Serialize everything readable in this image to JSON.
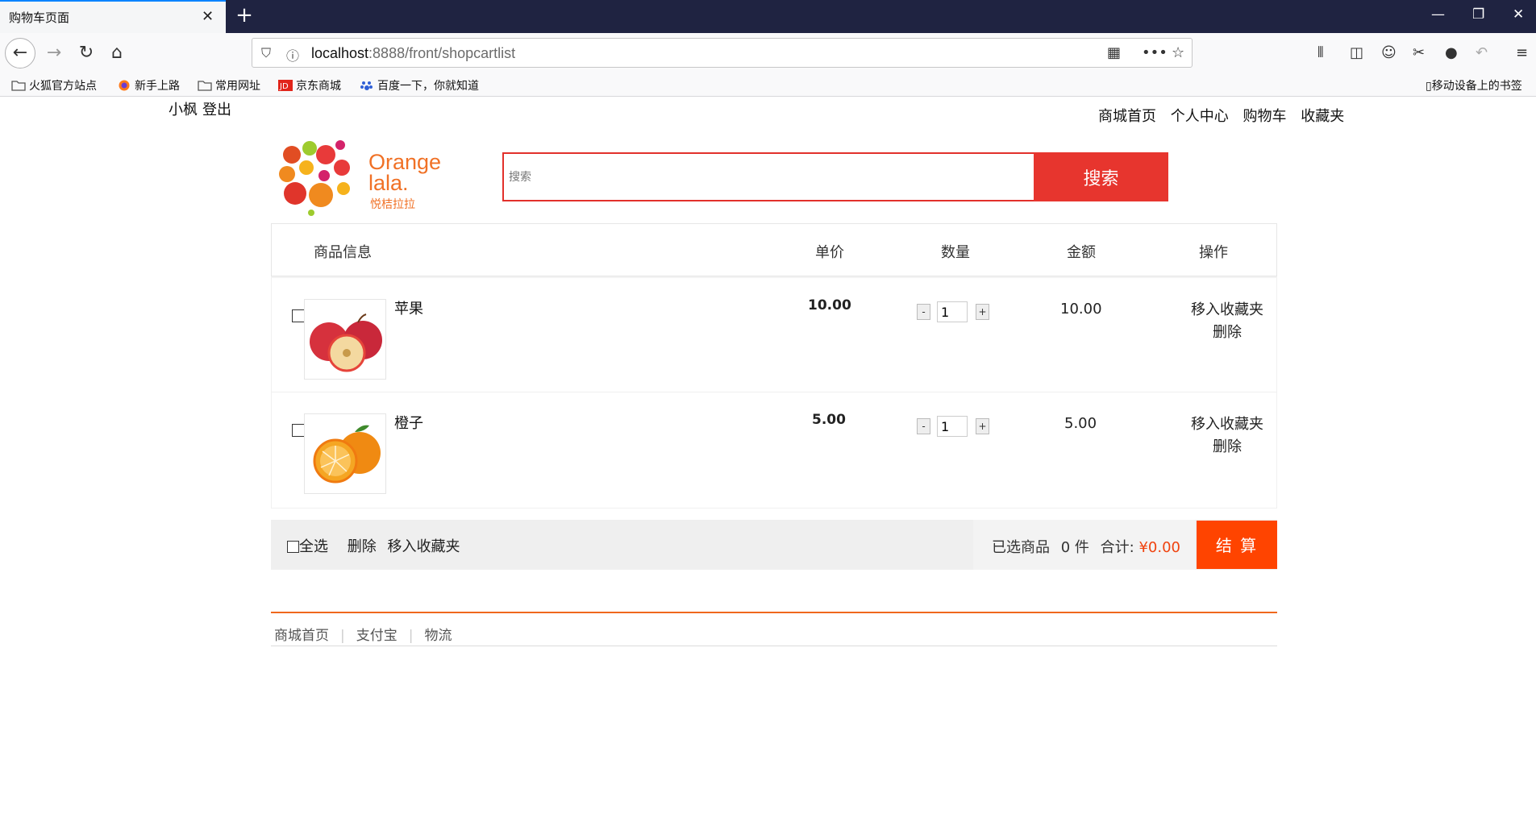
{
  "browser": {
    "tab_title": "购物车页面",
    "url_host": "localhost",
    "url_path": ":8888/front/shopcartlist",
    "bookmarks": [
      "火狐官方站点",
      "新手上路",
      "常用网址",
      "京东商城",
      "百度一下，你就知道"
    ],
    "mobile_bookmarks": "移动设备上的书签"
  },
  "user": {
    "name": "小枫",
    "logout": "登出"
  },
  "topnav": [
    "商城首页",
    "个人中心",
    "购物车",
    "收藏夹"
  ],
  "logo": {
    "line1": "Orange",
    "line2": "lala.",
    "cn": "悦桔拉拉"
  },
  "search": {
    "placeholder": "搜索",
    "button": "搜索"
  },
  "cart": {
    "headers": {
      "info": "商品信息",
      "price": "单价",
      "qty": "数量",
      "amount": "金额",
      "ops": "操作"
    },
    "items": [
      {
        "name": "苹果",
        "price": "10.00",
        "qty": "1",
        "amount": "10.00",
        "fav": "移入收藏夹",
        "delete": "删除"
      },
      {
        "name": "橙子",
        "price": "5.00",
        "qty": "1",
        "amount": "5.00",
        "fav": "移入收藏夹",
        "delete": "删除"
      }
    ]
  },
  "footer_bar": {
    "select_all": "全选",
    "delete": "删除",
    "move_fav": "移入收藏夹",
    "selected_label": "已选商品",
    "selected_count": "0",
    "unit": "件",
    "total_label": "合计:",
    "total": "¥0.00",
    "checkout": "结 算"
  },
  "footer_links": [
    "商城首页",
    "支付宝",
    "物流"
  ]
}
